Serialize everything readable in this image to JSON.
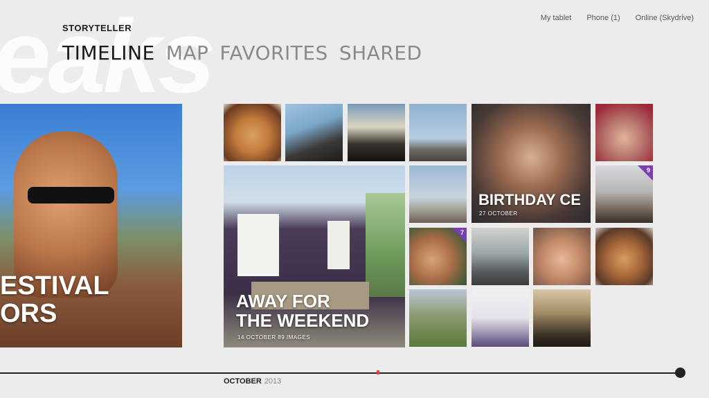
{
  "app": {
    "title": "STORYTELLER",
    "bg_word": "eaks"
  },
  "sources": [
    "My tablet",
    "Phone (1)",
    "Online (Skydrive)"
  ],
  "nav": [
    "TIMELINE",
    "MAP",
    "FAVORITES",
    "SHARED"
  ],
  "tiles": {
    "festival": {
      "line1": "ESTIVAL",
      "line2": "ORS"
    },
    "weekend": {
      "line1": "AWAY FOR",
      "line2": "THE WEEKEND",
      "sub": "14 OCTOBER 89 IMAGES"
    },
    "birthday": {
      "title": "BIRTHDAY CE",
      "date": "27 OCTOBER"
    },
    "badge_a": "9",
    "badge_b": "7"
  },
  "timeline": {
    "month": "OCTOBER",
    "year": "2013"
  },
  "colors": {
    "accent": "#7b3fb4",
    "background": "#ececec"
  }
}
